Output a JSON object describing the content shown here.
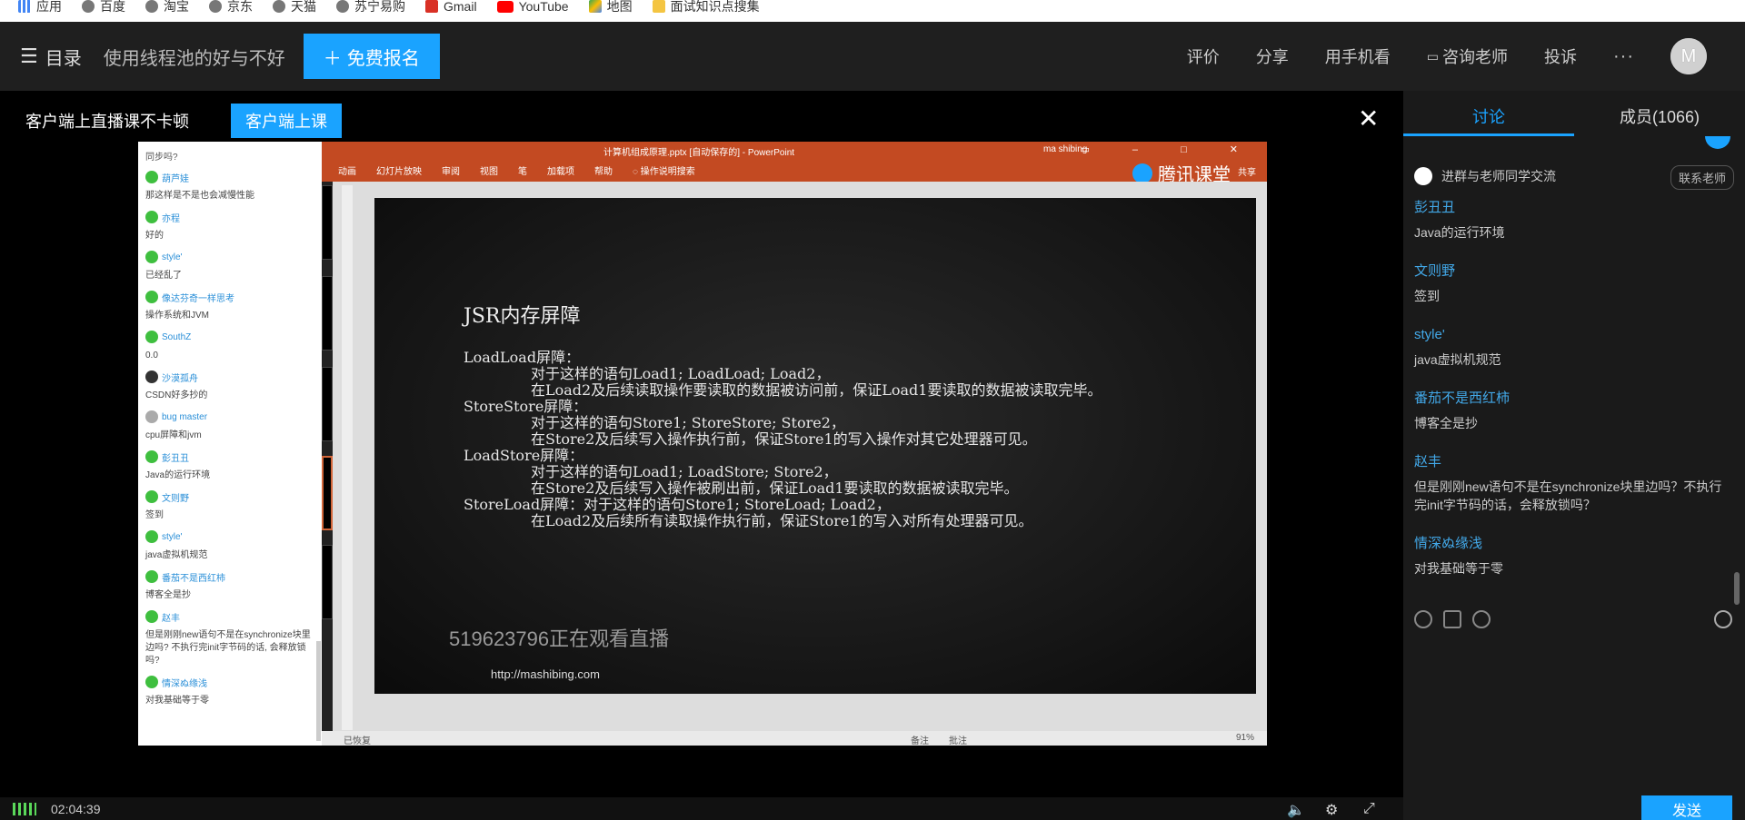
{
  "bookmarks": [
    {
      "label": "应用",
      "icon": "apps-grid-icon"
    },
    {
      "label": "百度",
      "icon": "globe-icon"
    },
    {
      "label": "淘宝",
      "icon": "globe-icon"
    },
    {
      "label": "京东",
      "icon": "globe-icon"
    },
    {
      "label": "天猫",
      "icon": "globe-icon"
    },
    {
      "label": "苏宁易购",
      "icon": "globe-icon"
    },
    {
      "label": "Gmail",
      "icon": "gmail-icon"
    },
    {
      "label": "YouTube",
      "icon": "youtube-icon"
    },
    {
      "label": "地图",
      "icon": "maps-icon"
    },
    {
      "label": "面试知识点搜集",
      "icon": "folder-icon"
    }
  ],
  "header": {
    "menu_label": "目录",
    "course_title": "使用线程池的好与不好",
    "signup_label": "免费报名",
    "actions": {
      "rate": "评价",
      "share": "分享",
      "mobile": "用手机看",
      "consult": "咨询老师",
      "report": "投诉",
      "more": "···"
    },
    "avatar_letter": "M"
  },
  "notice": {
    "text": "客户端上直播课不卡顿",
    "button": "客户端上课",
    "close": "✕"
  },
  "stream": {
    "chat": {
      "first_line": "同步吗?",
      "messages": [
        {
          "name": "葫芦娃",
          "text": "那这样是不是也会减慢性能"
        },
        {
          "name": "亦程",
          "text": "好的"
        },
        {
          "name": "style'",
          "text": "已经乱了"
        },
        {
          "name": "像达芬奇一样思考",
          "text": "操作系统和JVM"
        },
        {
          "name": "SouthZ",
          "text": "0.0"
        },
        {
          "name": "沙漠孤舟",
          "text": "CSDN好多抄的"
        },
        {
          "name": "bug master",
          "text": "cpu屏障和jvm"
        },
        {
          "name": "彭丑丑",
          "text": "Java的运行环境"
        },
        {
          "name": "文则野",
          "text": "签到"
        },
        {
          "name": "style'",
          "text": "java虚拟机规范"
        },
        {
          "name": "番茄不是西红柿",
          "text": "博客全是抄"
        },
        {
          "name": "赵丰",
          "text": "但是刚刚new语句不是在synchronize块里边吗? 不执行完init字节码的话, 会释放锁吗?"
        },
        {
          "name": "情深ぬ缘浅",
          "text": "对我基础等于零"
        }
      ]
    },
    "ppt": {
      "window_title": "计算机组成原理.pptx [自动保存的] - PowerPoint",
      "user": "ma shibing",
      "ribbon": [
        "动画",
        "幻灯片放映",
        "审阅",
        "视图",
        "笔",
        "加载项",
        "帮助",
        "操作说明搜索"
      ],
      "brand": "腾讯课堂",
      "share": "共享",
      "status_left": "已恢复",
      "status_notes": "备注",
      "status_comments": "批注",
      "zoom": "91%"
    },
    "slide": {
      "title": "JSR内存屏障",
      "lines": [
        "LoadLoad屏障：",
        "对于这样的语句Load1; LoadLoad; Load2，",
        "在Load2及后续读取操作要读取的数据被访问前，保证Load1要读取的数据被读取完毕。",
        "StoreStore屏障：",
        "对于这样的语句Store1; StoreStore; Store2，",
        "在Store2及后续写入操作执行前，保证Store1的写入操作对其它处理器可见。",
        "LoadStore屏障：",
        "对于这样的语句Load1; LoadStore; Store2，",
        "在Store2及后续写入操作被刷出前，保证Load1要读取的数据被读取完毕。",
        "StoreLoad屏障：对于这样的语句Store1; StoreLoad; Load2，",
        "在Load2及后续所有读取操作执行前，保证Store1的写入对所有处理器可见。"
      ],
      "watermark": "519623796正在观看直播",
      "url": "http://mashibing.com"
    }
  },
  "player": {
    "time": "02:04:39"
  },
  "sidebar": {
    "tabs": [
      "讨论",
      "成员(1066)"
    ],
    "group_text": "进群与老师同学交流",
    "contact_label": "联系老师",
    "messages": [
      {
        "name": "彭丑丑",
        "text": "Java的运行环境"
      },
      {
        "name": "文则野",
        "text": "签到"
      },
      {
        "name": "style'",
        "text": "java虚拟机规范"
      },
      {
        "name": "番茄不是西红柿",
        "text": "博客全是抄"
      },
      {
        "name": "赵丰",
        "text": "但是刚刚new语句不是在synchronize块里边吗？不执行完init字节码的话，会释放锁吗？"
      },
      {
        "name": "情深ぬ缘浅",
        "text": "对我基础等于零"
      }
    ],
    "send_label": "发送"
  },
  "colors": {
    "accent": "#1aa3ff",
    "ppt_orange": "#c34a22",
    "chat_name": "#42a8e8"
  }
}
